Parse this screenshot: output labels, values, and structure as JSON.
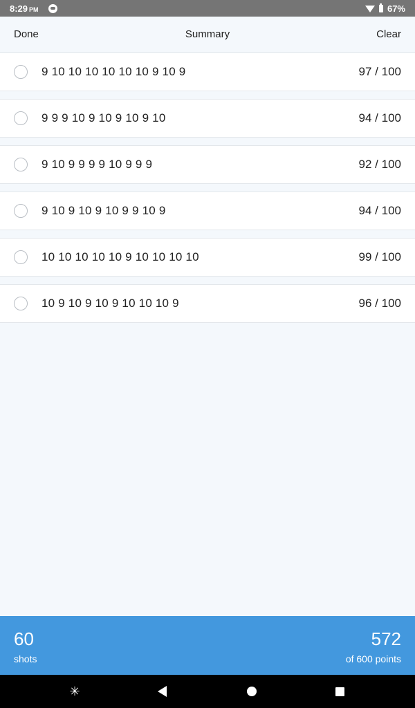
{
  "status_bar": {
    "time": "8:29",
    "ampm": "PM",
    "battery": "67%"
  },
  "header": {
    "done_label": "Done",
    "title": "Summary",
    "clear_label": "Clear"
  },
  "rows": [
    {
      "shots": "9 10 10 10 10 10 10 9 10 9",
      "score": "97 / 100"
    },
    {
      "shots": "9 9 9 10 9 10 9 10 9 10",
      "score": "94 / 100"
    },
    {
      "shots": "9 10 9 9 9 9 10 9 9 9",
      "score": "92 / 100"
    },
    {
      "shots": "9 10 9 10 9 10 9 9 10 9",
      "score": "94 / 100"
    },
    {
      "shots": "10 10 10 10 10 9 10 10 10 10",
      "score": "99 / 100"
    },
    {
      "shots": "10 9 10 9 10 9 10 10 10 9",
      "score": "96 / 100"
    }
  ],
  "footer": {
    "shots_count": "60",
    "shots_label": "shots",
    "points_total": "572",
    "points_label": "of 600 points"
  },
  "colors": {
    "accent": "#4398de",
    "background": "#f4f8fc",
    "status_bar": "#757575"
  },
  "icons": {
    "notification": "notification-icon",
    "wifi": "wifi-icon",
    "battery": "battery-icon",
    "radio": "radio-button",
    "nav_assistant": "assistant-spark-icon",
    "nav_back": "back-icon",
    "nav_home": "home-icon",
    "nav_recents": "recents-icon"
  }
}
